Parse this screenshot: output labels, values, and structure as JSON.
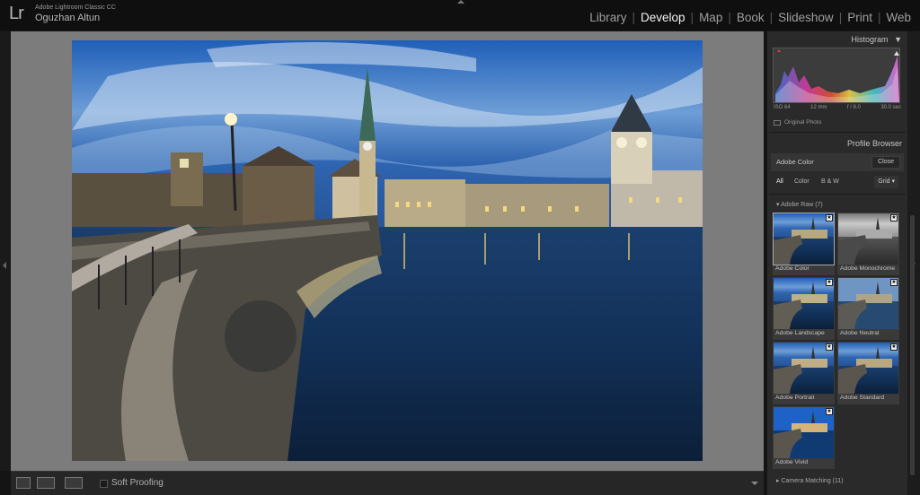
{
  "app": {
    "logo": "Lr",
    "name": "Adobe Lightroom Classic CC",
    "user": "Oguzhan Altun"
  },
  "modules": [
    "Library",
    "Develop",
    "Map",
    "Book",
    "Slideshow",
    "Print",
    "Web"
  ],
  "active_module": "Develop",
  "toolbar": {
    "soft_proofing_label": "Soft Proofing"
  },
  "histogram": {
    "title": "Histogram",
    "iso": "ISO 64",
    "focal": "12 mm",
    "aperture": "f / 8.0",
    "shutter": "30.0 sec",
    "original_photo": "Original Photo"
  },
  "profile_browser": {
    "title": "Profile Browser",
    "current_profile": "Adobe Color",
    "close_label": "Close",
    "filters": [
      "All",
      "Color",
      "B & W"
    ],
    "view_mode": "Grid",
    "group_adobe_raw": "Adobe Raw (7)",
    "profiles": [
      "Adobe Color",
      "Adobe Monochrome",
      "Adobe Landscape",
      "Adobe Neutral",
      "Adobe Portrait",
      "Adobe Standard",
      "Adobe Vivid"
    ],
    "group_camera_matching": "Camera Matching (11)"
  },
  "colors": {
    "accent": "#f2f2f2",
    "panel_bg": "#2a2a2a",
    "main_bg": "#7c7c7c"
  }
}
